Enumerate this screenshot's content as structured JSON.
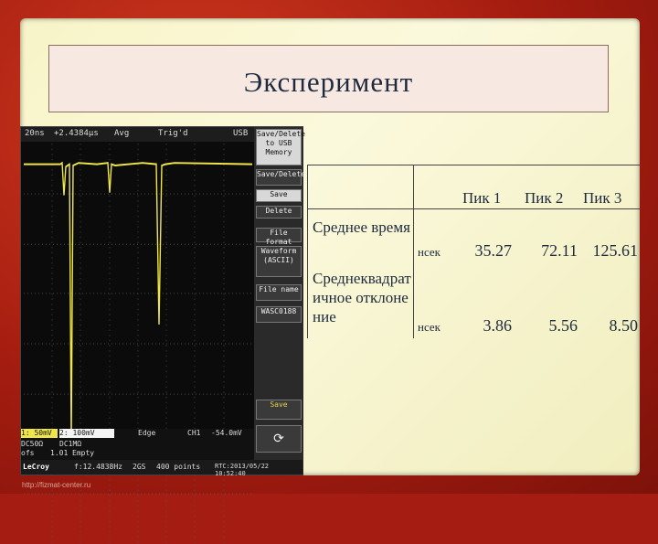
{
  "slide": {
    "title": "Эксперимент"
  },
  "scope": {
    "timebase": "20ns",
    "delay": "+2.4384μs",
    "mode": "Avg",
    "trig": "Trig'd",
    "usb": "USB",
    "side_buttons": [
      "Save/Delete to USB Memory",
      "Save/Delete",
      "Save",
      "Delete",
      "File format",
      "Waveform (ASCII)",
      "File name",
      "WASC0188",
      "Save"
    ],
    "edge": "Edge",
    "trig_level": "CH1",
    "trig_value": "-54.0mV",
    "ch1_label": "1:",
    "ch1_scale": "50mV",
    "ch2_label": "2:",
    "ch2_scale": "100mV",
    "ch1_coupling": "DC50Ω",
    "ch2_coupling": "DC1MΩ",
    "offs": "ofs",
    "offset_val": "1.01",
    "empty": "Empty",
    "brand": "LeCroy",
    "freq": "f:12.4838Hz",
    "samples": "2GS",
    "points": "400 points",
    "date": "RTC:2013/05/22 10:52:40",
    "watermark": "http://fizmat-center.ru"
  },
  "table": {
    "headers": [
      "Пик 1",
      "Пик 2",
      "Пик 3"
    ],
    "rows": [
      {
        "label": "Среднее время",
        "unit": "нсек",
        "values": [
          "35.27",
          "72.11",
          "125.61"
        ]
      },
      {
        "label": "Среднеквадратичное отклонение",
        "unit": "нсек",
        "values": [
          "3.86",
          "5.56",
          "8.50"
        ]
      }
    ]
  },
  "colors": {
    "background": "#a51d12",
    "slide": "#fbf9dc",
    "trace": "#f0e64a"
  }
}
